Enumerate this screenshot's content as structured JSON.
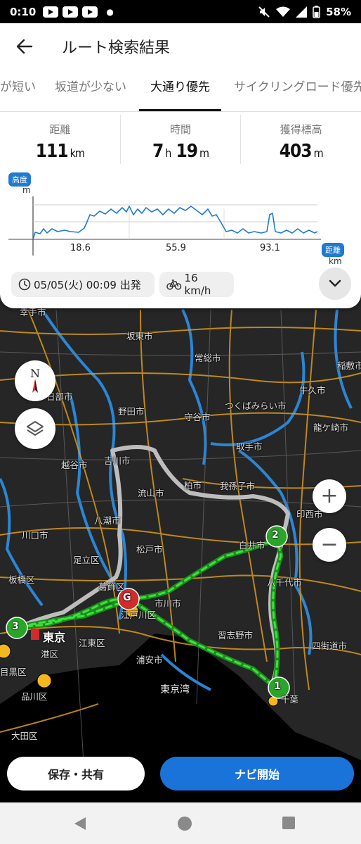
{
  "status_bar": {
    "time": "0:10",
    "battery": "58%"
  },
  "app_bar": {
    "title": "ルート検索結果",
    "back_icon": "arrow-left-icon"
  },
  "tabs": [
    {
      "label": "が短い",
      "active": false
    },
    {
      "label": "坂道が少ない",
      "active": false
    },
    {
      "label": "大通り優先",
      "active": true
    },
    {
      "label": "サイクリングロード優先",
      "active": false
    }
  ],
  "stats": {
    "distance": {
      "label": "距離",
      "value": "111",
      "unit": "km"
    },
    "time": {
      "label": "時間",
      "hours": "7",
      "h_unit": "h",
      "minutes": "19",
      "m_unit": "m"
    },
    "elevation": {
      "label": "獲得標高",
      "value": "403",
      "unit": "m"
    }
  },
  "elevation_chart": {
    "y_badge": "高度",
    "y_unit": "m",
    "x_badge": "距離",
    "x_unit": "km",
    "ticks": [
      "18.6",
      "55.9",
      "93.1"
    ],
    "line_color": "#1f7ad1"
  },
  "departure": {
    "label": "05/05(火) 00:09 出発",
    "icon": "clock-icon"
  },
  "speed": {
    "label": "16 km/h",
    "icon": "bicycle-icon"
  },
  "map": {
    "labels": [
      "幸手市",
      "坂東市",
      "常総市",
      "稲敷市",
      "日部市",
      "牛久市",
      "つくばみらい市",
      "野田市",
      "守谷市",
      "龍ケ崎市",
      "吉川市",
      "取手市",
      "越谷市",
      "流山市",
      "我孫子市",
      "柏市",
      "印西市",
      "八潮市",
      "白井市",
      "川口市",
      "足立区",
      "松戸市",
      "板橋区",
      "葛飾区",
      "八千代市",
      "市川市",
      "江戸川区",
      "東京",
      "江東区",
      "習志野市",
      "四街道市",
      "港区",
      "浦安市",
      "目黒区",
      "東京湾",
      "品川区",
      "千葉",
      "大田区"
    ],
    "waypoints": [
      "1",
      "2",
      "3",
      "G"
    ],
    "route_color": "#22c322",
    "road_color": "#e0a020"
  },
  "buttons": {
    "save_share": "保存・共有",
    "navigate": "ナビ開始"
  }
}
